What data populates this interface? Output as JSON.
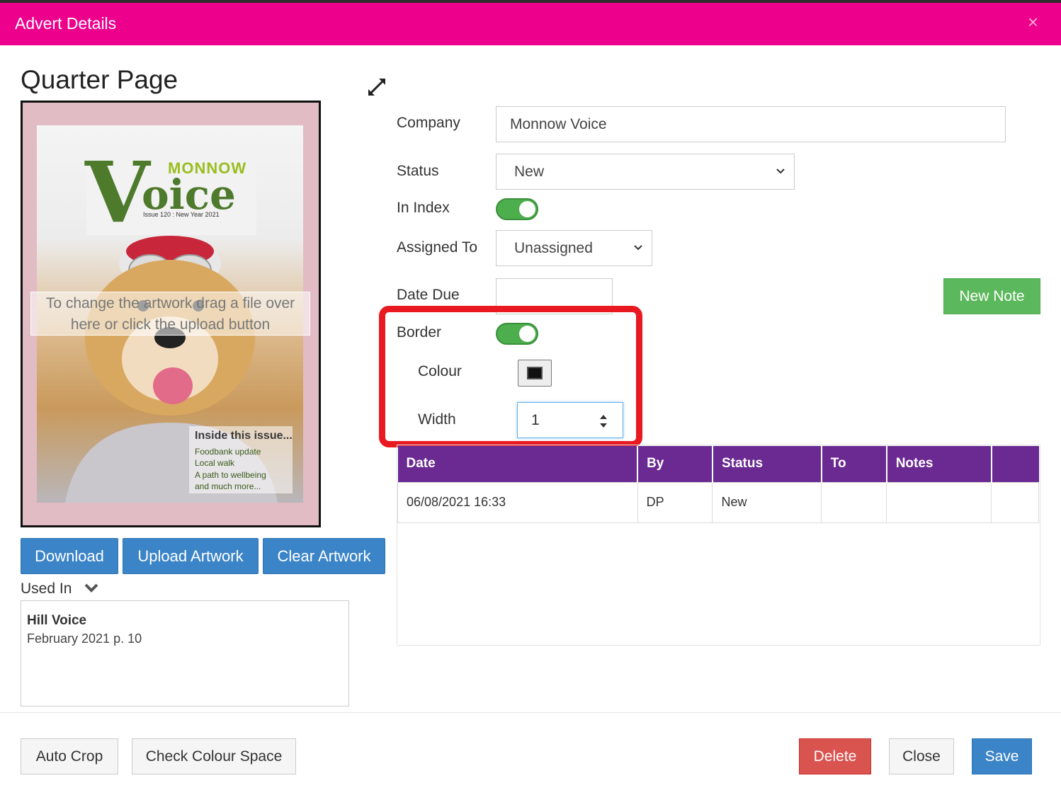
{
  "dialog": {
    "title": "Advert Details",
    "close_glyph": "×"
  },
  "advert": {
    "size_title": "Quarter Page",
    "drop_hint": "To change the artwork drag a file over here or click the upload button",
    "cover": {
      "logo_small": "MONNOW",
      "logo_big": "oice",
      "logo_initial": "V",
      "issue_line": "Issue 120 : New Year 2021",
      "inside_title": "Inside this issue...",
      "inside_items": [
        "Foodbank update",
        "Local walk",
        "A path to wellbeing",
        "and much more..."
      ]
    }
  },
  "buttons": {
    "download": "Download",
    "upload": "Upload Artwork",
    "clear": "Clear Artwork",
    "new_note": "New Note",
    "auto_crop": "Auto Crop",
    "check_colour": "Check Colour Space",
    "delete": "Delete",
    "close": "Close",
    "save": "Save"
  },
  "used_in": {
    "label": "Used In",
    "items": [
      {
        "publication": "Hill Voice",
        "detail": "February 2021 p. 10"
      }
    ]
  },
  "form": {
    "company_label": "Company",
    "company_value": "Monnow Voice",
    "status_label": "Status",
    "status_value": "New",
    "in_index_label": "In Index",
    "in_index_on": true,
    "assigned_label": "Assigned To",
    "assigned_value": "Unassigned",
    "date_due_label": "Date Due",
    "date_due_value": "",
    "border_label": "Border",
    "border_on": true,
    "colour_label": "Colour",
    "colour_value": "#111111",
    "width_label": "Width",
    "width_value": "1"
  },
  "notes_table": {
    "headers": [
      "Date",
      "By",
      "Status",
      "To",
      "Notes",
      ""
    ],
    "rows": [
      [
        "06/08/2021 16:33",
        "DP",
        "New",
        "",
        "",
        ""
      ]
    ]
  },
  "colors": {
    "header": "#ec008c",
    "table_header": "#6a2a91",
    "primary": "#3b84c8",
    "success": "#5cb85c",
    "danger": "#d9534f",
    "highlight": "#e81920"
  }
}
